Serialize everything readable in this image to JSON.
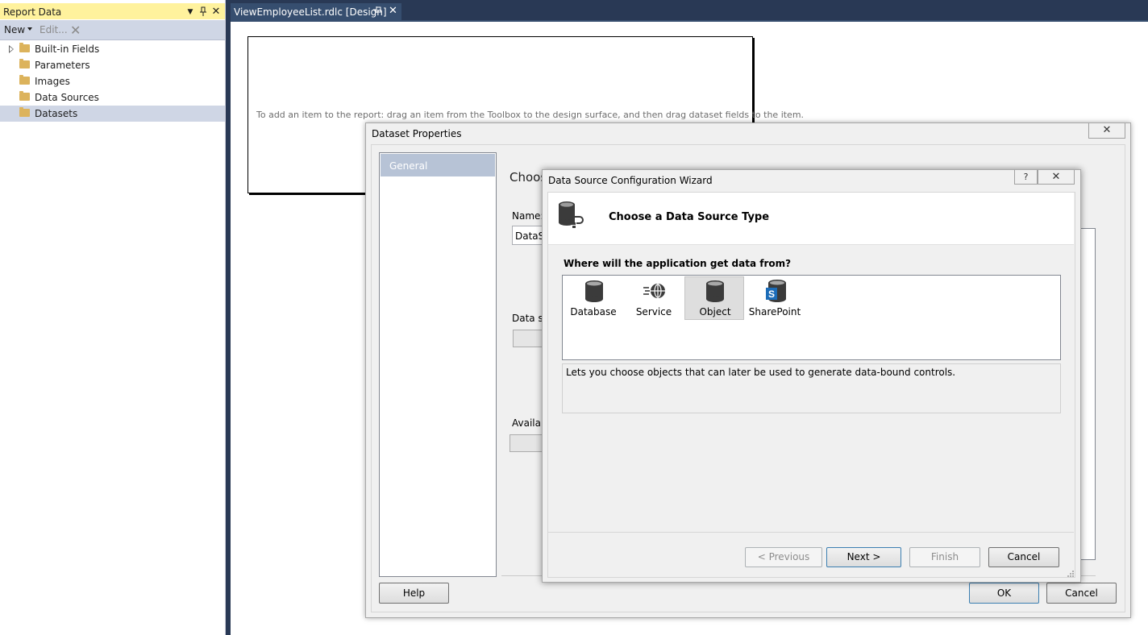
{
  "report_pane": {
    "title": "Report Data",
    "toolbar": {
      "new_label": "New",
      "edit_label": "Edit...",
      "delete_glyph": "✕"
    },
    "tree": [
      {
        "label": "Built-in Fields",
        "expandable": true
      },
      {
        "label": "Parameters",
        "expandable": false
      },
      {
        "label": "Images",
        "expandable": false
      },
      {
        "label": "Data Sources",
        "expandable": false
      },
      {
        "label": "Datasets",
        "expandable": false,
        "selected": true
      }
    ]
  },
  "document_tab": {
    "label": "ViewEmployeeList.rdlc [Design]"
  },
  "design_surface": {
    "hint": "To add an item to the report: drag an item from the Toolbox to the design surface, and then drag dataset fields to the item."
  },
  "dataset_properties": {
    "title": "Dataset Properties",
    "nav": [
      {
        "label": "General",
        "selected": true
      }
    ],
    "heading": "Choos",
    "name_label": "Name:",
    "name_value": "DataSe",
    "data_source_label": "Data so",
    "available_label": "Availab",
    "help_button": "Help",
    "ok_button": "OK",
    "cancel_button": "Cancel"
  },
  "wizard": {
    "title": "Data Source Configuration Wizard",
    "help_glyph": "?",
    "header_title": "Choose a Data Source Type",
    "question": "Where will the application get data from?",
    "types": [
      {
        "label": "Database",
        "icon": "database-icon",
        "selected": false
      },
      {
        "label": "Service",
        "icon": "service-icon",
        "selected": false
      },
      {
        "label": "Object",
        "icon": "object-icon",
        "selected": true
      },
      {
        "label": "SharePoint",
        "icon": "sharepoint-icon",
        "selected": false
      }
    ],
    "description": "Lets you choose objects that can later be used to generate data-bound controls.",
    "buttons": {
      "previous": "< Previous",
      "next": "Next >",
      "finish": "Finish",
      "cancel": "Cancel"
    }
  },
  "colors": {
    "vs_dark": "#293955",
    "pane_title_bg": "#fff29d",
    "selection": "#cfd6e5",
    "nav_selected": "#b7c3d6",
    "dialog_bg": "#f0f0f0"
  }
}
